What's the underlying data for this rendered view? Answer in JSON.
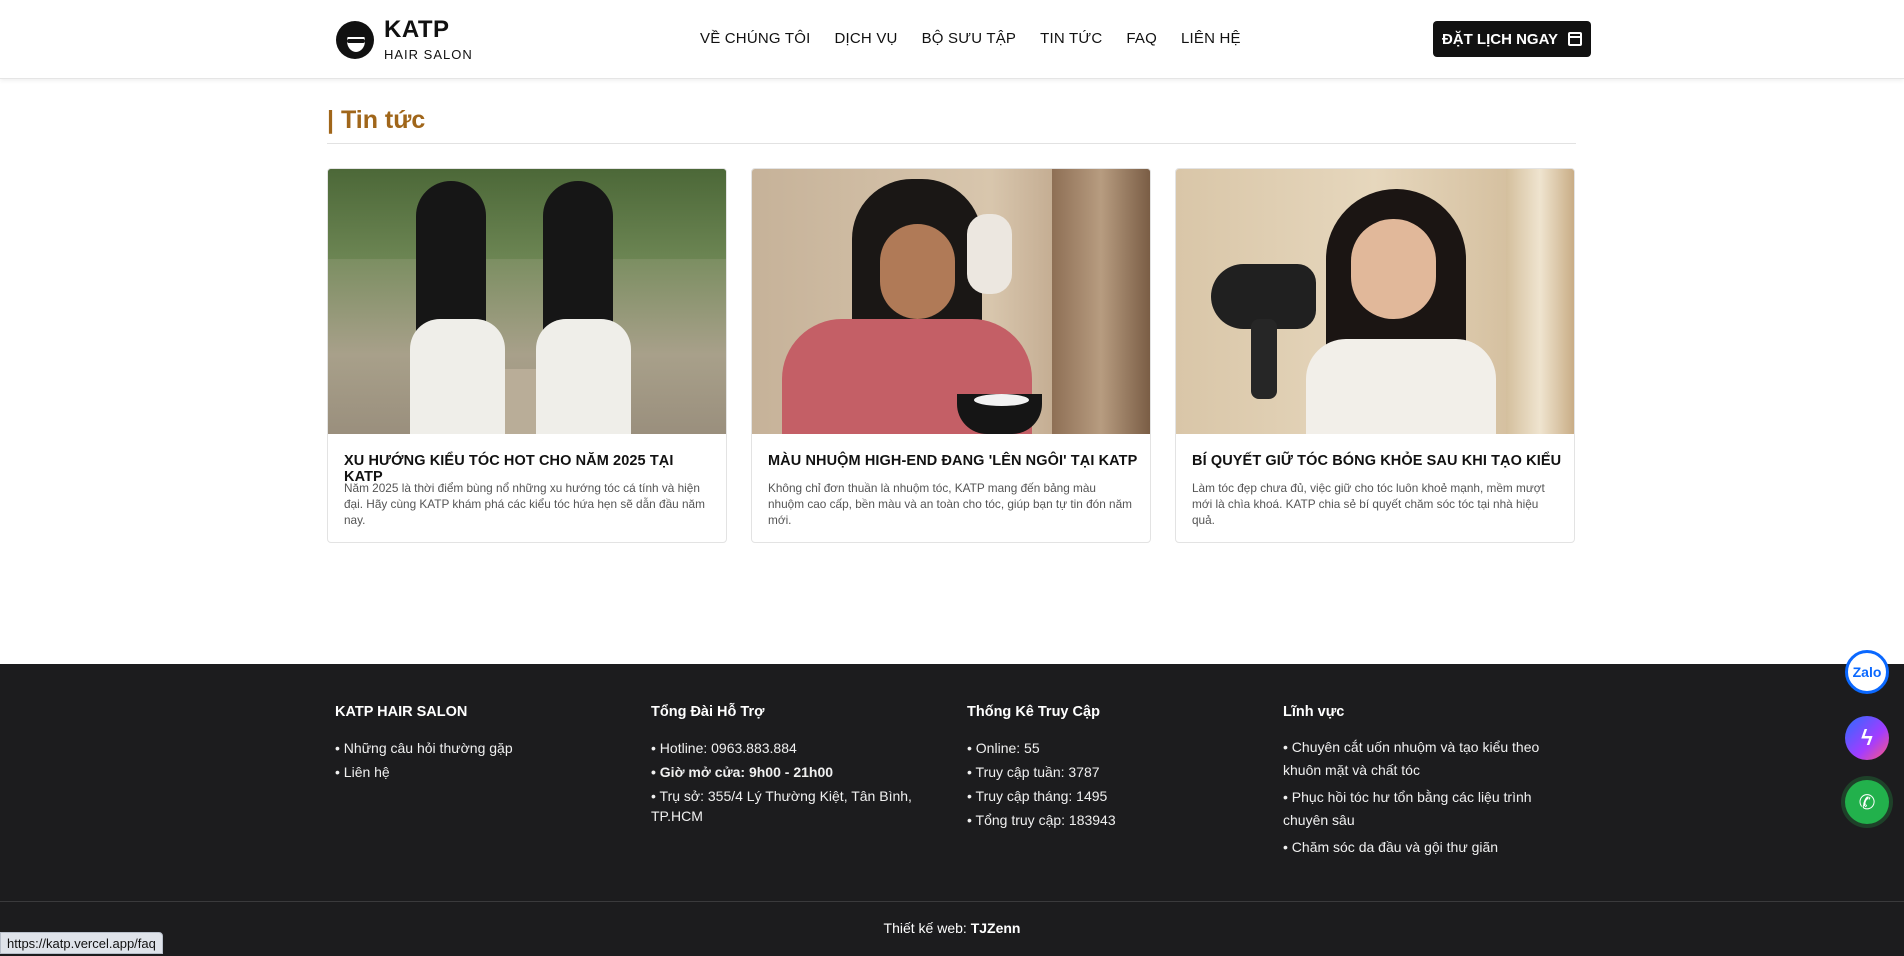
{
  "header": {
    "brand": "KATP",
    "brand_sub": "HAIR SALON",
    "nav": [
      "VỀ CHÚNG TÔI",
      "DỊCH VỤ",
      "BỘ SƯU TẬP",
      "TIN TỨC",
      "FAQ",
      "LIÊN HỆ"
    ],
    "cta_label": "ĐẶT LỊCH NGAY",
    "cta_icon": "calendar-icon"
  },
  "section": {
    "title": "| Tin tức"
  },
  "cards": [
    {
      "title": "XU HƯỚNG KIỂU TÓC HOT CHO NĂM 2025 TẠI KATP",
      "desc": "Năm 2025 là thời điểm bùng nổ những xu hướng tóc cá tính và hiện đại. Hãy cùng KATP khám phá các kiểu tóc hứa hẹn sẽ dẫn đầu năm nay."
    },
    {
      "title": "MÀU NHUỘM HIGH-END ĐANG 'LÊN NGÔI' TẠI KATP",
      "desc": "Không chỉ đơn thuần là nhuộm tóc, KATP mang đến bảng màu nhuộm cao cấp, bền màu và an toàn cho tóc, giúp bạn tự tin đón năm mới."
    },
    {
      "title": "BÍ QUYẾT GIỮ TÓC BÓNG KHỎE SAU KHI TẠO KIỂU",
      "desc": "Làm tóc đẹp chưa đủ, việc giữ cho tóc luôn khoẻ mạnh, mềm mượt mới là chìa khoá. KATP chia sẻ bí quyết chăm sóc tóc tại nhà hiệu quả."
    }
  ],
  "footer": {
    "col1": {
      "heading": "KATP HAIR SALON",
      "items": [
        "• Những câu hỏi thường gặp",
        "• Liên hệ"
      ]
    },
    "col2": {
      "heading": "Tổng Đài Hỗ Trợ",
      "hotline": "• Hotline: 0963.883.884",
      "hours": "• Giờ mở cửa: 9h00 - 21h00",
      "address": "• Trụ sở: 355/4 Lý Thường Kiệt, Tân Bình, TP.HCM"
    },
    "col3": {
      "heading": "Thống Kê Truy Cập",
      "items": [
        "• Online: 55",
        "• Truy cập tuần: 3787",
        "• Truy cập tháng: 1495",
        "• Tổng truy cập: 183943"
      ]
    },
    "col4": {
      "heading": "Lĩnh vực",
      "items": [
        "•   Chuyên cắt uốn nhuộm và tạo kiểu theo khuôn mặt và chất tóc",
        "•   Phục hồi tóc hư tổn bằng các liệu trình chuyên sâu",
        "•   Chăm sóc da đầu và gội thư giãn"
      ]
    },
    "credit_prefix": "Thiết kế web: ",
    "credit_name": "TJZenn"
  },
  "floating": {
    "zalo_label": "Zalo",
    "messenger_icon": "messenger-icon",
    "phone_icon": "phone-icon"
  },
  "status_bar": {
    "url": "https://katp.vercel.app/faq"
  }
}
